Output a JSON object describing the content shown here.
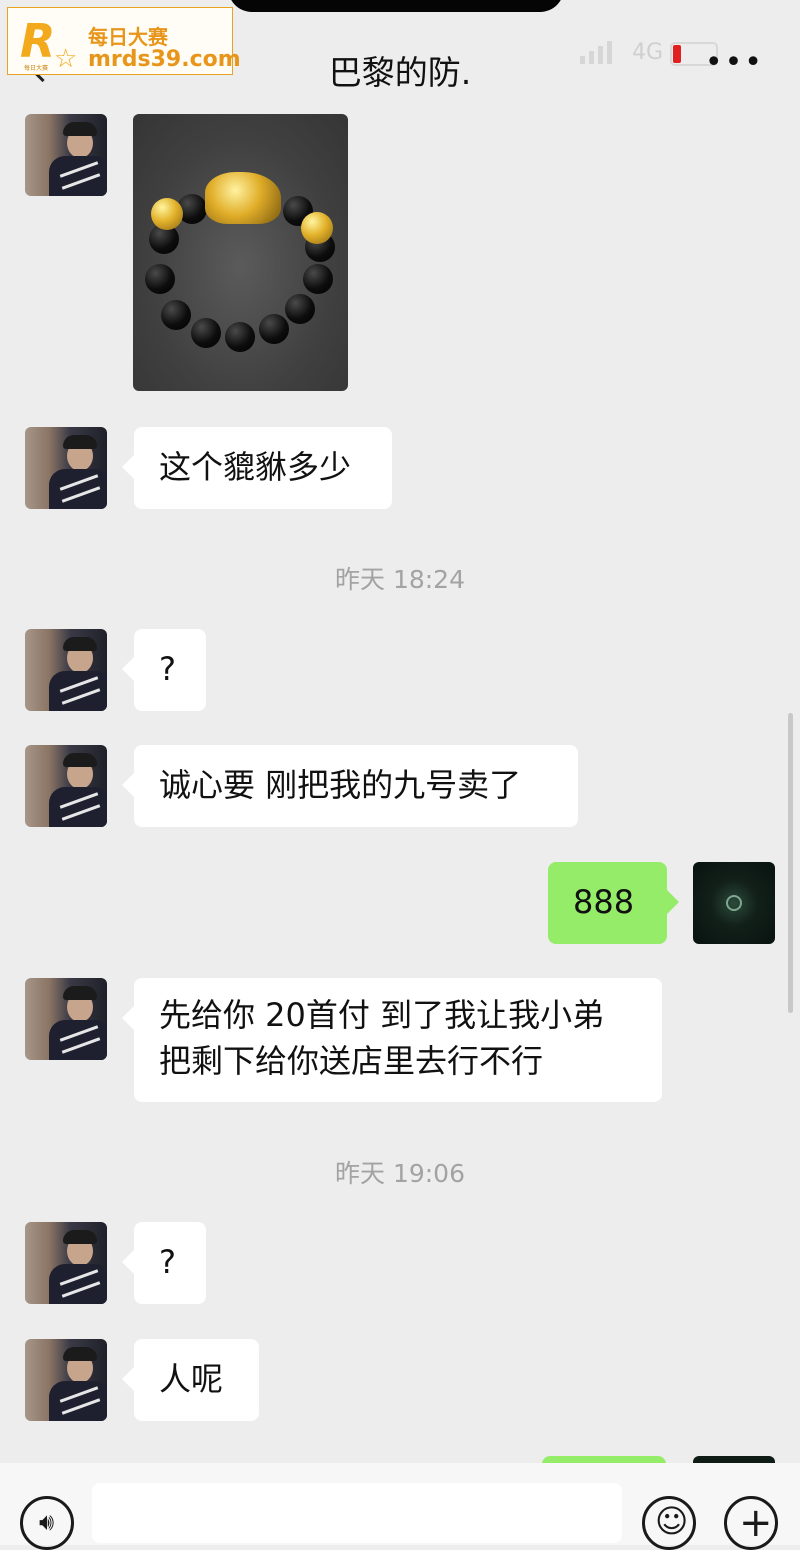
{
  "watermark": {
    "logo": "R",
    "star": "☆",
    "small": "每日大赛",
    "cn": "每日大赛",
    "url": "mrds39.com"
  },
  "header": {
    "title": "巴黎的防.",
    "network": "4G",
    "more": "•••"
  },
  "messages": [
    {
      "type": "image",
      "sender": "other",
      "alt": "black bead bracelet with gold pixiu"
    },
    {
      "type": "text",
      "sender": "other",
      "lines": [
        "这个貔貅多少"
      ]
    },
    {
      "type": "time",
      "text": "昨天 18:24"
    },
    {
      "type": "text",
      "sender": "other",
      "lines": [
        "?"
      ]
    },
    {
      "type": "text",
      "sender": "other",
      "lines": [
        "诚心要 刚把我的九号卖了"
      ]
    },
    {
      "type": "text",
      "sender": "self",
      "lines": [
        "888"
      ]
    },
    {
      "type": "text",
      "sender": "other",
      "lines": [
        "先给你 20首付 到了我让我小弟",
        "把剩下给你送店里去行不行"
      ]
    },
    {
      "type": "time",
      "text": "昨天 19:06"
    },
    {
      "type": "text",
      "sender": "other",
      "lines": [
        "?"
      ]
    },
    {
      "type": "text",
      "sender": "other",
      "lines": [
        "人呢"
      ]
    }
  ],
  "inputbar": {
    "voice_icon": "voice-icon",
    "emoji_icon": "emoji-icon",
    "plus_icon": "plus-icon",
    "voice": "🔊︎",
    "emoji": "☺",
    "plus": "+"
  }
}
